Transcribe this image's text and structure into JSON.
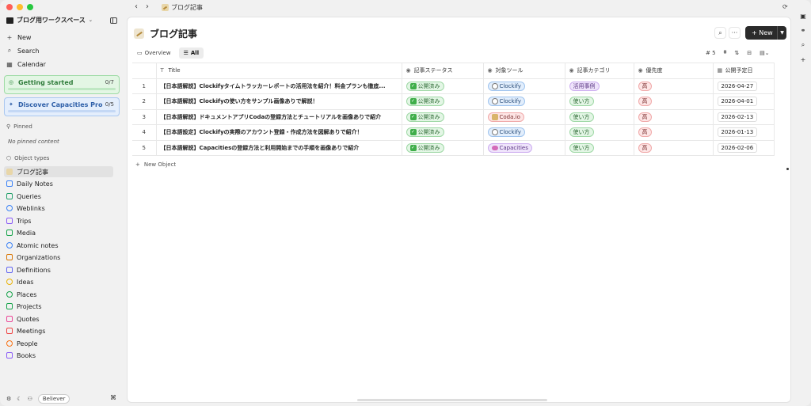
{
  "colors": {
    "accent": "#2b2b2b",
    "green": "#3fae4a"
  },
  "titlebar": {
    "breadcrumb": "ブログ記事",
    "icon": "pencil-emoji-icon"
  },
  "sidebar": {
    "workspace": "ブログ用ワークスペース",
    "top_items": [
      {
        "label": "New",
        "icon": "plus-icon"
      },
      {
        "label": "Search",
        "icon": "search-icon"
      },
      {
        "label": "Calendar",
        "icon": "calendar-icon"
      }
    ],
    "cards": [
      {
        "title": "Getting started",
        "count": "0/7"
      },
      {
        "title": "Discover Capacities Pro",
        "count": "0/5"
      }
    ],
    "pinned_label": "Pinned",
    "pinned_empty": "No pinned content",
    "object_types_label": "Object types",
    "object_types": [
      "ブログ記事",
      "Daily Notes",
      "Queries",
      "Weblinks",
      "Trips",
      "Media",
      "Atomic notes",
      "Organizations",
      "Definitions",
      "Ideas",
      "Places",
      "Projects",
      "Quotes",
      "Meetings",
      "People",
      "Books"
    ],
    "footer": {
      "badge": "Believer",
      "shortcut": "⌘"
    }
  },
  "main": {
    "title": "ブログ記事",
    "new_button": "New",
    "tabs": [
      {
        "label": "Overview"
      },
      {
        "label": "All"
      }
    ],
    "row_count": "5",
    "columns": [
      "Title",
      "記事ステータス",
      "対象ツール",
      "記事カテゴリ",
      "優先度",
      "公開予定日"
    ],
    "rows": [
      {
        "num": "1",
        "title": "【日本語解説】Clockifyタイムトラッカーレポートの活用法を紹介！料金プランも徹底...",
        "status": "公開済み",
        "tool": "Clockify",
        "tool_kind": "clock",
        "category": "活用事例",
        "priority": "高",
        "date": "2026-04-27"
      },
      {
        "num": "2",
        "title": "【日本語解説】Clockifyの使い方をサンプル画像ありで解説！",
        "status": "公開済み",
        "tool": "Clockify",
        "tool_kind": "clock",
        "category": "使い方",
        "priority": "高",
        "date": "2026-04-01"
      },
      {
        "num": "3",
        "title": "【日本語解説】ドキュメントアプリCodaの登録方法とチュートリアルを画像ありで紹介",
        "status": "公開済み",
        "tool": "Coda.io",
        "tool_kind": "coda",
        "category": "使い方",
        "priority": "高",
        "date": "2026-02-13"
      },
      {
        "num": "4",
        "title": "【日本語設定】Clockifyの実際のアカウント登録・作成方法を図解ありで紹介！",
        "status": "公開済み",
        "tool": "Clockify",
        "tool_kind": "clock",
        "category": "使い方",
        "priority": "高",
        "date": "2026-01-13"
      },
      {
        "num": "5",
        "title": "【日本語解説】Capacitiesの登録方法と利用開始までの手順を画像ありで紹介",
        "status": "公開済み",
        "tool": "Capacities",
        "tool_kind": "cap",
        "category": "使い方",
        "priority": "高",
        "date": "2026-02-06"
      }
    ],
    "new_object": "New Object"
  }
}
